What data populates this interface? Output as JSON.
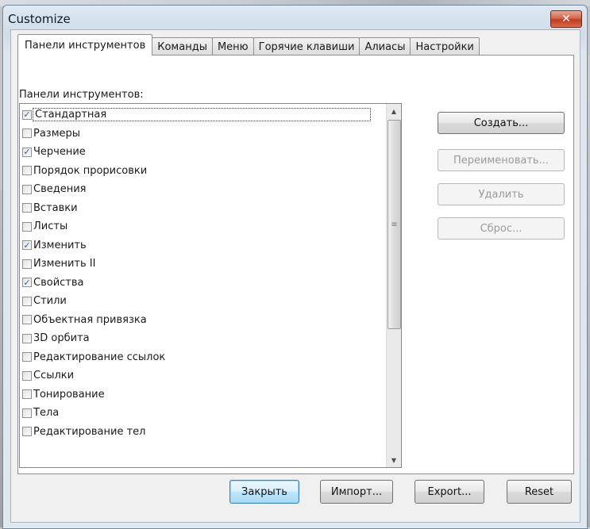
{
  "window": {
    "title": "Customize",
    "close_glyph": "✕"
  },
  "tabs": [
    {
      "label": "Панели инструментов",
      "active": true
    },
    {
      "label": "Команды",
      "active": false
    },
    {
      "label": "Меню",
      "active": false
    },
    {
      "label": "Горячие клавиши",
      "active": false
    },
    {
      "label": "Алиасы",
      "active": false
    },
    {
      "label": "Настройки",
      "active": false
    }
  ],
  "toolbars_panel": {
    "list_label": "Панели инструментов:",
    "items": [
      {
        "label": "Стандартная",
        "checked": true
      },
      {
        "label": "Размеры",
        "checked": false
      },
      {
        "label": "Черчение",
        "checked": true
      },
      {
        "label": "Порядок прорисовки",
        "checked": false
      },
      {
        "label": "Сведения",
        "checked": false
      },
      {
        "label": "Вставки",
        "checked": false
      },
      {
        "label": "Листы",
        "checked": false
      },
      {
        "label": "Изменить",
        "checked": true
      },
      {
        "label": "Изменить II",
        "checked": false
      },
      {
        "label": "Свойства",
        "checked": true
      },
      {
        "label": "Стили",
        "checked": false
      },
      {
        "label": "Объектная привязка",
        "checked": false
      },
      {
        "label": "3D орбита",
        "checked": false
      },
      {
        "label": "Редактирование ссылок",
        "checked": false
      },
      {
        "label": "Ссылки",
        "checked": false
      },
      {
        "label": "Тонирование",
        "checked": false
      },
      {
        "label": "Тела",
        "checked": false
      },
      {
        "label": "Редактирование тел",
        "checked": false
      }
    ],
    "side_buttons": {
      "create": "Создать...",
      "rename": "Переименовать...",
      "delete": "Удалить",
      "reset": "Сброс..."
    }
  },
  "bottom_buttons": {
    "close": "Закрыть",
    "import": "Импорт...",
    "export": "Export...",
    "reset": "Reset"
  }
}
